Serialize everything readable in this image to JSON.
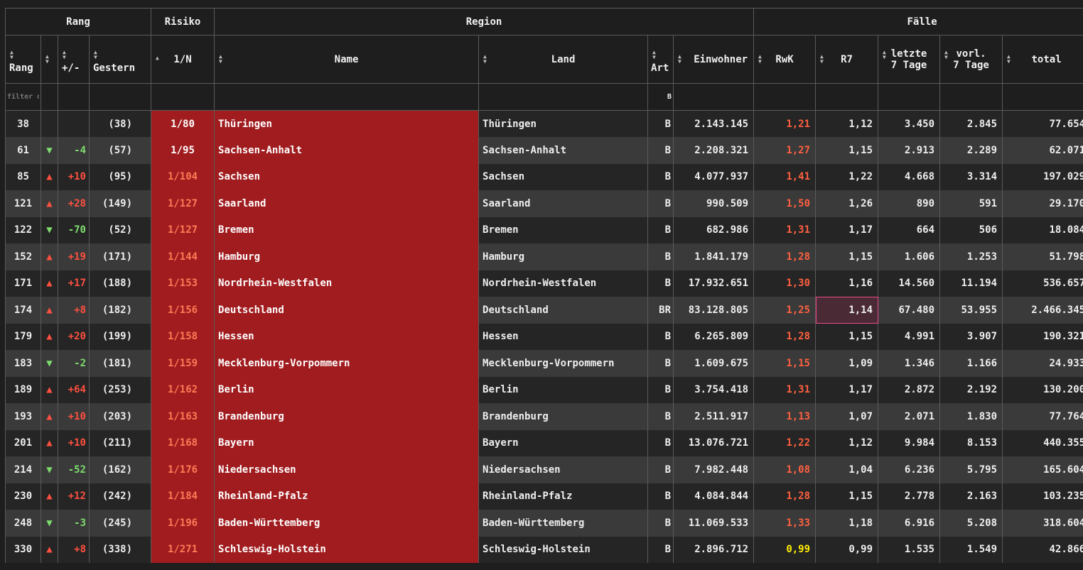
{
  "groups": {
    "rang": "Rang",
    "risiko": "Risiko",
    "region": "Region",
    "faelle": "Fälle"
  },
  "columns": {
    "rang": "Rang",
    "delta": "+/-",
    "gestern": "Gestern",
    "risk": "1/N",
    "name": "Name",
    "land": "Land",
    "art": "Art",
    "einwohner": "Einwohner",
    "rwk": "RwK",
    "r7": "R7",
    "letzte_line1": "letzte",
    "letzte_line2": "7 Tage",
    "vorl_line1": "vorl.",
    "vorl_line2": "7 Tage",
    "total": "total"
  },
  "filters": {
    "rang_placeholder": "filter data...",
    "art_value": "B"
  },
  "rows": [
    {
      "rang": "38",
      "dir": "",
      "delta": "",
      "gestern": "(38)",
      "risk": "1/80",
      "risk_level": "high",
      "name": "Thüringen",
      "land": "Thüringen",
      "art": "B",
      "einwohner": "2.143.145",
      "rwk": "1,21",
      "r7": "1,12",
      "letzte": "3.450",
      "vorl": "2.845",
      "total": "77.654"
    },
    {
      "rang": "61",
      "dir": "▼",
      "delta": "-4",
      "gestern": "(57)",
      "risk": "1/95",
      "risk_level": "high",
      "name": "Sachsen-Anhalt",
      "land": "Sachsen-Anhalt",
      "art": "B",
      "einwohner": "2.208.321",
      "rwk": "1,27",
      "r7": "1,15",
      "letzte": "2.913",
      "vorl": "2.289",
      "total": "62.071"
    },
    {
      "rang": "85",
      "dir": "▲",
      "delta": "+10",
      "gestern": "(95)",
      "risk": "1/104",
      "risk_level": "normal",
      "name": "Sachsen",
      "land": "Sachsen",
      "art": "B",
      "einwohner": "4.077.937",
      "rwk": "1,41",
      "r7": "1,22",
      "letzte": "4.668",
      "vorl": "3.314",
      "total": "197.029"
    },
    {
      "rang": "121",
      "dir": "▲",
      "delta": "+28",
      "gestern": "(149)",
      "risk": "1/127",
      "risk_level": "normal",
      "name": "Saarland",
      "land": "Saarland",
      "art": "B",
      "einwohner": "990.509",
      "rwk": "1,50",
      "r7": "1,26",
      "letzte": "890",
      "vorl": "591",
      "total": "29.170"
    },
    {
      "rang": "122",
      "dir": "▼",
      "delta": "-70",
      "gestern": "(52)",
      "risk": "1/127",
      "risk_level": "normal",
      "name": "Bremen",
      "land": "Bremen",
      "art": "B",
      "einwohner": "682.986",
      "rwk": "1,31",
      "r7": "1,17",
      "letzte": "664",
      "vorl": "506",
      "total": "18.084"
    },
    {
      "rang": "152",
      "dir": "▲",
      "delta": "+19",
      "gestern": "(171)",
      "risk": "1/144",
      "risk_level": "normal",
      "name": "Hamburg",
      "land": "Hamburg",
      "art": "B",
      "einwohner": "1.841.179",
      "rwk": "1,28",
      "r7": "1,15",
      "letzte": "1.606",
      "vorl": "1.253",
      "total": "51.798"
    },
    {
      "rang": "171",
      "dir": "▲",
      "delta": "+17",
      "gestern": "(188)",
      "risk": "1/153",
      "risk_level": "normal",
      "name": "Nordrhein-Westfalen",
      "land": "Nordrhein-Westfalen",
      "art": "B",
      "einwohner": "17.932.651",
      "rwk": "1,30",
      "r7": "1,16",
      "letzte": "14.560",
      "vorl": "11.194",
      "total": "536.657"
    },
    {
      "rang": "174",
      "dir": "▲",
      "delta": "+8",
      "gestern": "(182)",
      "risk": "1/156",
      "risk_level": "normal",
      "name": "Deutschland",
      "land": "Deutschland",
      "art": "BR",
      "einwohner": "83.128.805",
      "rwk": "1,25",
      "r7": "1,14",
      "letzte": "67.480",
      "vorl": "53.955",
      "total": "2.466.345",
      "r7_highlight": true
    },
    {
      "rang": "179",
      "dir": "▲",
      "delta": "+20",
      "gestern": "(199)",
      "risk": "1/158",
      "risk_level": "normal",
      "name": "Hessen",
      "land": "Hessen",
      "art": "B",
      "einwohner": "6.265.809",
      "rwk": "1,28",
      "r7": "1,15",
      "letzte": "4.991",
      "vorl": "3.907",
      "total": "190.321"
    },
    {
      "rang": "183",
      "dir": "▼",
      "delta": "-2",
      "gestern": "(181)",
      "risk": "1/159",
      "risk_level": "normal",
      "name": "Mecklenburg-Vorpommern",
      "land": "Mecklenburg-Vorpommern",
      "art": "B",
      "einwohner": "1.609.675",
      "rwk": "1,15",
      "r7": "1,09",
      "letzte": "1.346",
      "vorl": "1.166",
      "total": "24.933"
    },
    {
      "rang": "189",
      "dir": "▲",
      "delta": "+64",
      "gestern": "(253)",
      "risk": "1/162",
      "risk_level": "normal",
      "name": "Berlin",
      "land": "Berlin",
      "art": "B",
      "einwohner": "3.754.418",
      "rwk": "1,31",
      "r7": "1,17",
      "letzte": "2.872",
      "vorl": "2.192",
      "total": "130.200"
    },
    {
      "rang": "193",
      "dir": "▲",
      "delta": "+10",
      "gestern": "(203)",
      "risk": "1/163",
      "risk_level": "normal",
      "name": "Brandenburg",
      "land": "Brandenburg",
      "art": "B",
      "einwohner": "2.511.917",
      "rwk": "1,13",
      "r7": "1,07",
      "letzte": "2.071",
      "vorl": "1.830",
      "total": "77.764"
    },
    {
      "rang": "201",
      "dir": "▲",
      "delta": "+10",
      "gestern": "(211)",
      "risk": "1/168",
      "risk_level": "normal",
      "name": "Bayern",
      "land": "Bayern",
      "art": "B",
      "einwohner": "13.076.721",
      "rwk": "1,22",
      "r7": "1,12",
      "letzte": "9.984",
      "vorl": "8.153",
      "total": "440.355"
    },
    {
      "rang": "214",
      "dir": "▼",
      "delta": "-52",
      "gestern": "(162)",
      "risk": "1/176",
      "risk_level": "normal",
      "name": "Niedersachsen",
      "land": "Niedersachsen",
      "art": "B",
      "einwohner": "7.982.448",
      "rwk": "1,08",
      "r7": "1,04",
      "letzte": "6.236",
      "vorl": "5.795",
      "total": "165.604"
    },
    {
      "rang": "230",
      "dir": "▲",
      "delta": "+12",
      "gestern": "(242)",
      "risk": "1/184",
      "risk_level": "normal",
      "name": "Rheinland-Pfalz",
      "land": "Rheinland-Pfalz",
      "art": "B",
      "einwohner": "4.084.844",
      "rwk": "1,28",
      "r7": "1,15",
      "letzte": "2.778",
      "vorl": "2.163",
      "total": "103.235"
    },
    {
      "rang": "248",
      "dir": "▼",
      "delta": "-3",
      "gestern": "(245)",
      "risk": "1/196",
      "risk_level": "normal",
      "name": "Baden-Württemberg",
      "land": "Baden-Württemberg",
      "art": "B",
      "einwohner": "11.069.533",
      "rwk": "1,33",
      "r7": "1,18",
      "letzte": "6.916",
      "vorl": "5.208",
      "total": "318.604"
    },
    {
      "rang": "330",
      "dir": "▲",
      "delta": "+8",
      "gestern": "(338)",
      "risk": "1/271",
      "risk_level": "normal",
      "name": "Schleswig-Holstein",
      "land": "Schleswig-Holstein",
      "art": "B",
      "einwohner": "2.896.712",
      "rwk": "0,99",
      "r7": "0,99",
      "letzte": "1.535",
      "vorl": "1.549",
      "total": "42.866",
      "rwk_low": true
    }
  ],
  "colors": {
    "risk_bg": "#a01c1f",
    "up": "#ff5040",
    "down": "#7edc6e",
    "rwk": "#ff6040",
    "rwk_low": "#ffee00"
  },
  "icons": {
    "sort": "sort-both-icon",
    "up": "triangle-up-icon",
    "down": "triangle-down-icon"
  }
}
